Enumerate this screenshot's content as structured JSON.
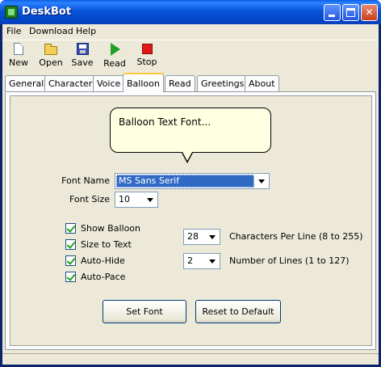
{
  "window": {
    "title": "DeskBot"
  },
  "menu": [
    "File",
    "Download",
    "Help"
  ],
  "toolbar": [
    {
      "label": "New",
      "icon": "new-file-icon"
    },
    {
      "label": "Open",
      "icon": "open-folder-icon"
    },
    {
      "label": "Save",
      "icon": "save-disk-icon"
    },
    {
      "label": "Read",
      "icon": "play-icon"
    },
    {
      "label": "Stop",
      "icon": "stop-icon"
    }
  ],
  "tabs": [
    "General",
    "Character",
    "Voice",
    "Balloon",
    "Read",
    "Greetings",
    "About"
  ],
  "active_tab": "Balloon",
  "balloon": {
    "preview_text": "Balloon Text Font...",
    "font_name_label": "Font Name",
    "font_name_value": "MS Sans Serif",
    "font_size_label": "Font Size",
    "font_size_value": "10",
    "checkboxes": [
      {
        "label": "Show Balloon",
        "checked": true
      },
      {
        "label": "Size to Text",
        "checked": true
      },
      {
        "label": "Auto-Hide",
        "checked": true
      },
      {
        "label": "Auto-Pace",
        "checked": true
      }
    ],
    "chars_per_line_value": "28",
    "chars_per_line_label": "Characters Per Line (8 to 255)",
    "num_lines_value": "2",
    "num_lines_label": "Number of Lines (1 to 127)",
    "set_font_button": "Set Font",
    "reset_button": "Reset to Default"
  },
  "colors": {
    "title_bar": "#0853d9",
    "selection": "#316ac5",
    "balloon_bg": "#ffffe1",
    "active_tab_accent": "#ffc83c"
  }
}
